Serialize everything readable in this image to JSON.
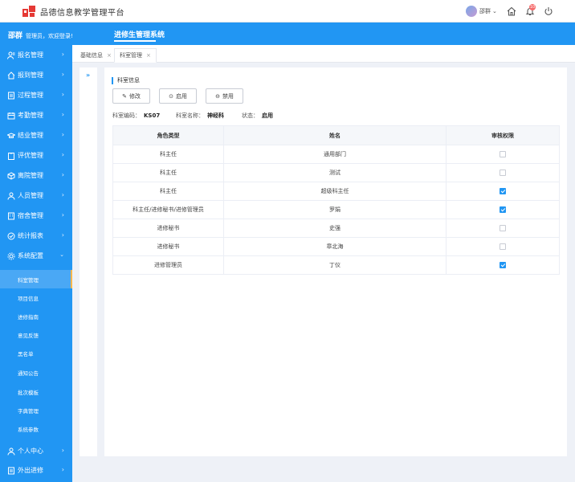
{
  "header": {
    "app_title": "品德信息教学管理平台",
    "user_name": "邵群",
    "notification_count": "10",
    "greeting_name": "邵群",
    "greeting_text": "管理员，欢迎登录!",
    "system_title": "进修生管理系统"
  },
  "sidebar": {
    "items": [
      {
        "label": "报名管理"
      },
      {
        "label": "报到管理"
      },
      {
        "label": "过程管理"
      },
      {
        "label": "考勤管理"
      },
      {
        "label": "结业管理"
      },
      {
        "label": "评优管理"
      },
      {
        "label": "离院管理"
      },
      {
        "label": "人员管理"
      },
      {
        "label": "宿舍管理"
      },
      {
        "label": "统计报表"
      },
      {
        "label": "系统配置"
      }
    ],
    "sub_items": [
      {
        "label": "科室管理"
      },
      {
        "label": "项目信息"
      },
      {
        "label": "进修指南"
      },
      {
        "label": "意见反馈"
      },
      {
        "label": "黑名单"
      },
      {
        "label": "通知公告"
      },
      {
        "label": "批次模板"
      },
      {
        "label": "字典管理"
      },
      {
        "label": "系统参数"
      }
    ],
    "bottom_items": [
      {
        "label": "个人中心"
      },
      {
        "label": "外出进修"
      }
    ]
  },
  "tabs": [
    {
      "label": "基础信息"
    },
    {
      "label": "科室管理"
    }
  ],
  "section": {
    "title": "科室信息",
    "buttons": {
      "edit": "修改",
      "enable": "启用",
      "disable": "禁用"
    },
    "code_label": "科室编码：",
    "code_value": "KS07",
    "name_label": "科室名称：",
    "name_value": "神经科",
    "status_label": "状态：",
    "status_value": "启用"
  },
  "table": {
    "headers": [
      "角色类型",
      "姓名",
      "审核权限"
    ],
    "rows": [
      {
        "role": "科主任",
        "name": "通用部门",
        "checked": false
      },
      {
        "role": "科主任",
        "name": "测试",
        "checked": false
      },
      {
        "role": "科主任",
        "name": "超级科主任",
        "checked": true
      },
      {
        "role": "科主任/进修秘书/进修管理员",
        "name": "罗娟",
        "checked": true
      },
      {
        "role": "进修秘书",
        "name": "史强",
        "checked": false
      },
      {
        "role": "进修秘书",
        "name": "章北海",
        "checked": false
      },
      {
        "role": "进修管理员",
        "name": "丁仪",
        "checked": true
      }
    ]
  },
  "colors": {
    "primary": "#2196f3",
    "accent": "#ffb74d",
    "brand": "#e53935"
  }
}
